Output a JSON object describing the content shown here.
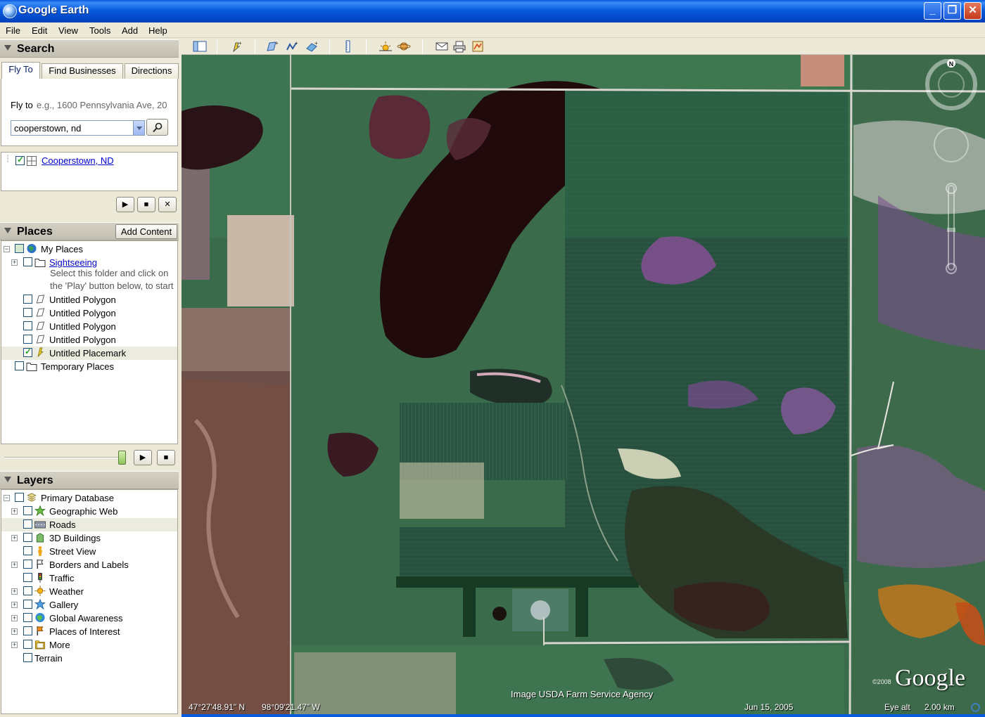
{
  "window": {
    "title": "Google Earth",
    "controls": {
      "minimize": "_",
      "maximize": "❐",
      "close": "✕"
    }
  },
  "menu": [
    "File",
    "Edit",
    "View",
    "Tools",
    "Add",
    "Help"
  ],
  "search": {
    "header": "Search",
    "tabs": [
      "Fly To",
      "Find Businesses",
      "Directions"
    ],
    "active_tab": "Fly To",
    "flyto_label": "Fly to",
    "flyto_hint": "e.g., 1600 Pennsylvania Ave, 20",
    "query": "cooperstown, nd",
    "result": "Cooperstown, ND",
    "result_checked": true
  },
  "places": {
    "header": "Places",
    "add_content": "Add Content",
    "items": [
      {
        "label": "My Places",
        "checked": false,
        "icon": "globe-icon"
      },
      {
        "label": "Sightseeing",
        "checked": false,
        "icon": "folder-icon",
        "link": true
      },
      {
        "label": "Untitled Polygon",
        "checked": false,
        "icon": "polygon-icon"
      },
      {
        "label": "Untitled Polygon",
        "checked": false,
        "icon": "polygon-icon"
      },
      {
        "label": "Untitled Polygon",
        "checked": false,
        "icon": "polygon-icon"
      },
      {
        "label": "Untitled Polygon",
        "checked": false,
        "icon": "polygon-icon"
      },
      {
        "label": "Untitled Placemark",
        "checked": true,
        "icon": "placemark-icon"
      },
      {
        "label": "Temporary Places",
        "checked": false,
        "icon": "folder-icon"
      }
    ],
    "sightseeing_desc_1": "Select this folder and click on",
    "sightseeing_desc_2": "the 'Play' button below, to start"
  },
  "layers": {
    "header": "Layers",
    "items": [
      {
        "label": "Primary Database",
        "icon": "database-icon"
      },
      {
        "label": "Geographic Web",
        "icon": "star-icon"
      },
      {
        "label": "Roads",
        "icon": "roads-icon"
      },
      {
        "label": "3D Buildings",
        "icon": "building-icon"
      },
      {
        "label": "Street View",
        "icon": "pegman-icon"
      },
      {
        "label": "Borders and Labels",
        "icon": "flag-icon"
      },
      {
        "label": "Traffic",
        "icon": "traffic-light-icon"
      },
      {
        "label": "Weather",
        "icon": "sun-icon"
      },
      {
        "label": "Gallery",
        "icon": "star-icon"
      },
      {
        "label": "Global Awareness",
        "icon": "globe-icon"
      },
      {
        "label": "Places of Interest",
        "icon": "flag-icon"
      },
      {
        "label": "More",
        "icon": "folder-icon"
      },
      {
        "label": "Terrain",
        "icon": ""
      }
    ]
  },
  "map": {
    "credit": "Image USDA Farm Service Agency",
    "latitude": "47°27'48.91\" N",
    "longitude": "98°09'21.47\" W",
    "imagery_date": "Jun 15, 2005",
    "eye_alt_label": "Eye alt",
    "eye_alt_value": "2.00 km",
    "copyright": "©2008",
    "logo": "Google",
    "compass_north": "N"
  },
  "colors": {
    "titlebar": "#0a5cdf",
    "link": "#0000cc",
    "panel": "#ece9d8"
  }
}
